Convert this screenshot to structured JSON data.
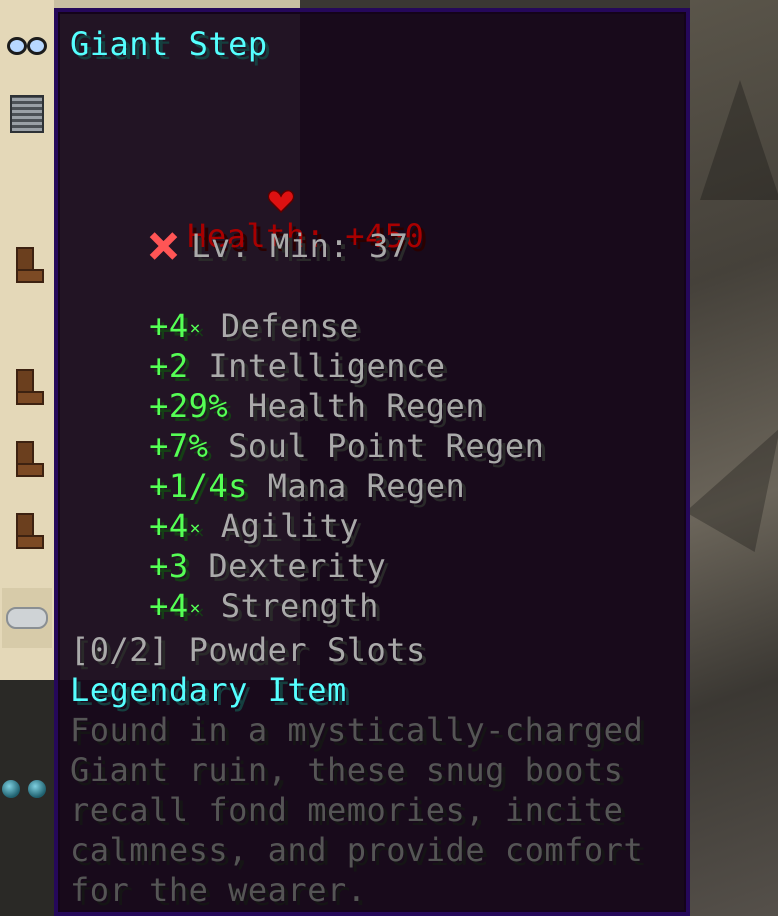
{
  "tooltip": {
    "item_name": "Giant Step",
    "health": {
      "icon": "heart-icon",
      "text": "Health: +450"
    },
    "level_req": {
      "icon": "cross-icon",
      "text": "Lv. Min: 37"
    },
    "identifications": [
      {
        "value": "+4",
        "star": "×",
        "label": "Defense"
      },
      {
        "value": "+2",
        "star": "",
        "label": "Intelligence"
      },
      {
        "value": "+29%",
        "star": "",
        "label": "Health Regen"
      },
      {
        "value": "+7%",
        "star": "",
        "label": "Soul Point Regen"
      },
      {
        "value": "+1/4s",
        "star": "",
        "label": "Mana Regen"
      },
      {
        "value": "+4",
        "star": "×",
        "label": "Agility"
      },
      {
        "value": "+3",
        "star": "",
        "label": "Dexterity"
      },
      {
        "value": "+4",
        "star": "×",
        "label": "Strength"
      }
    ],
    "powder_slots": "[0/2] Powder Slots",
    "rarity": "Legendary Item",
    "lore": [
      "Found in a mystically-charged",
      "Giant ruin, these snug boots",
      "recall fond memories, incite",
      "calmness, and provide comfort",
      "for the wearer."
    ]
  },
  "colors": {
    "name": "#55ffff",
    "health": "#aa0000",
    "stat_value": "#55ff55",
    "label": "#aaaaaa",
    "lore": "#555555",
    "border": "#25085a",
    "background": "#16061a"
  },
  "inventory": {
    "slot_icons": [
      "glasses-icon",
      "chestplate-icon",
      "boots-icon",
      "boots-icon",
      "boots-icon",
      "boots-icon",
      "cloud-icon"
    ]
  }
}
